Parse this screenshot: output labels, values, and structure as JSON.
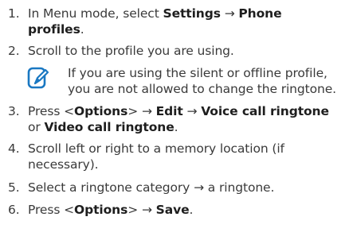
{
  "steps": [
    {
      "num": "1.",
      "p1": "In Menu mode, select ",
      "b1": "Settings",
      "p2": " → ",
      "b2": "Phone",
      "line2_b": "profiles",
      "line2_p": "."
    },
    {
      "num": "2.",
      "text": "Scroll to the profile you are using."
    },
    {
      "num": "3.",
      "p1": "Press <",
      "b1": "Options",
      "p2": "> → ",
      "b2": "Edit",
      "p3": " → ",
      "b3": "Voice call ringtone",
      "line2_p1": "or ",
      "line2_b": "Video call ringtone",
      "line2_p2": "."
    },
    {
      "num": "4.",
      "line1": "Scroll left or right to a memory location (if",
      "line2": "necessary)."
    },
    {
      "num": "5.",
      "text": "Select a ringtone category → a ringtone."
    },
    {
      "num": "6.",
      "p1": "Press <",
      "b1": "Options",
      "p2": "> → ",
      "b2": "Save",
      "p3": "."
    }
  ],
  "note": {
    "icon": "note-pencil-icon",
    "line1": "If you are using the silent or offline profile,",
    "line2": "you are not allowed to change the ringtone."
  }
}
